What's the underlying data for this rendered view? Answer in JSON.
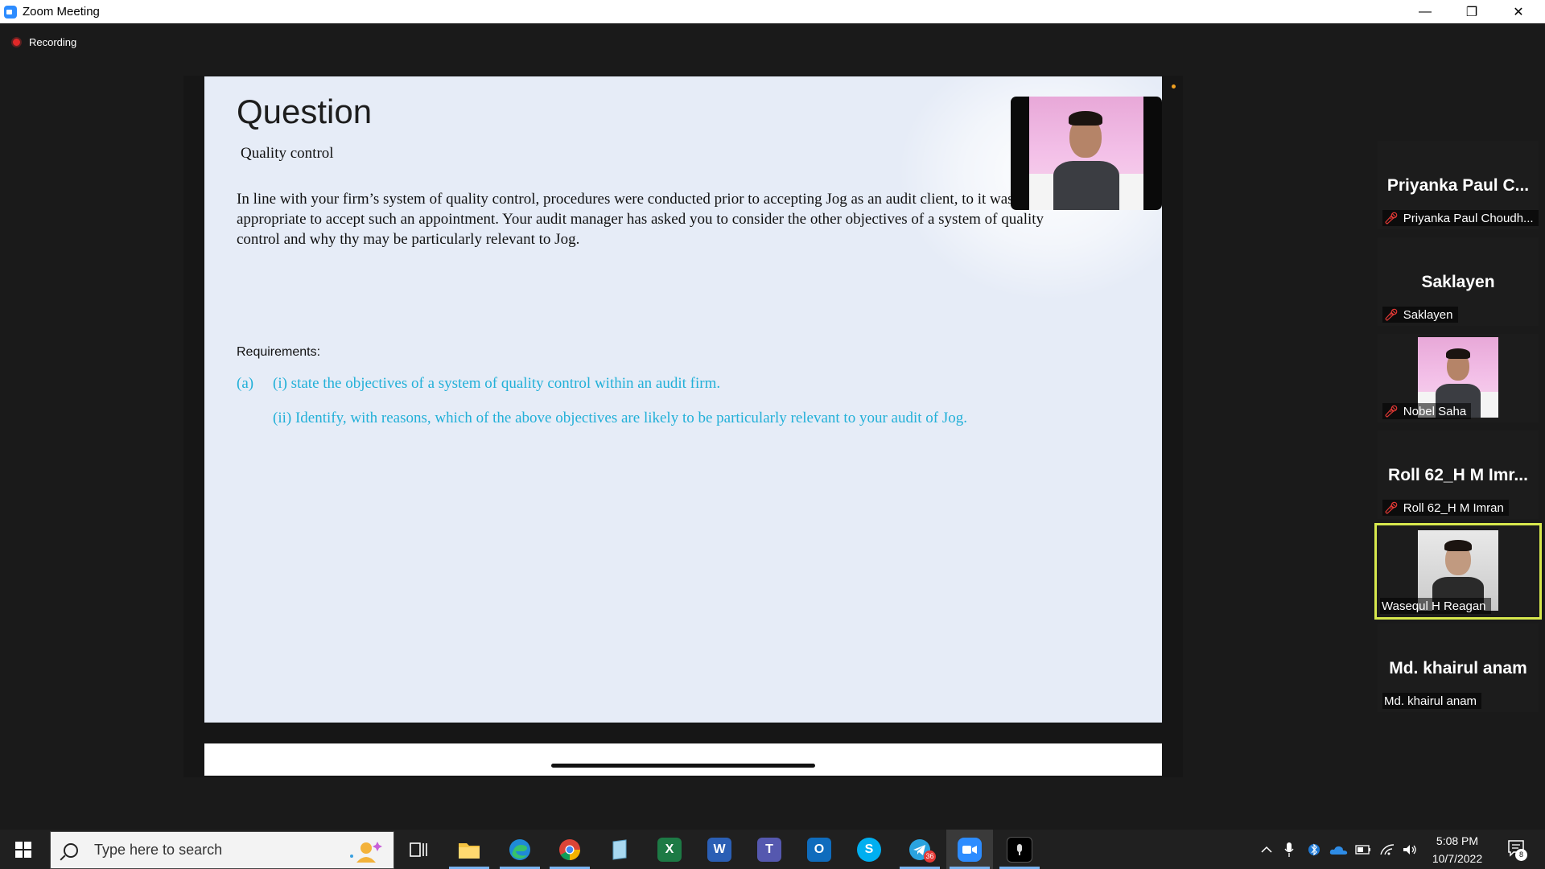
{
  "window": {
    "title": "Zoom Meeting"
  },
  "recording": {
    "label": "Recording"
  },
  "slide": {
    "title": "Question",
    "subtitle": "Quality control",
    "body": "In line with your firm’s system of quality control, procedures were conducted prior to accepting Jog as an audit client, to it was appropriate to accept such an appointment. Your audit manager has asked you to consider the other objectives of a system of quality control and why thy may be particularly relevant to Jog.",
    "requirements_label": "Requirements:",
    "item_label": "(a)",
    "item_i": "(i) state the objectives of a system of quality control within an audit firm.",
    "item_ii": "(ii) Identify, with reasons, which of the above objectives are likely to be particularly relevant to your audit of Jog."
  },
  "participants": [
    {
      "big_name": "Priyanka Paul C...",
      "name": "Priyanka Paul Choudh...",
      "muted": true,
      "video": false,
      "speaking": false
    },
    {
      "big_name": "Saklayen",
      "name": "Saklayen",
      "muted": true,
      "video": false,
      "speaking": false
    },
    {
      "big_name": "",
      "name": "Nobel Saha",
      "muted": true,
      "video": true,
      "speaking": false
    },
    {
      "big_name": "Roll 62_H M Imr...",
      "name": "Roll 62_H M Imran",
      "muted": true,
      "video": false,
      "speaking": false
    },
    {
      "big_name": "",
      "name": "Wasequl H Reagan",
      "muted": false,
      "video": true,
      "speaking": true
    },
    {
      "big_name": "Md. khairul anam",
      "name": "Md. khairul anam",
      "muted": false,
      "video": false,
      "speaking": false
    }
  ],
  "taskbar": {
    "search_placeholder": "Type here to search",
    "apps": [
      {
        "icon": "task-view-icon"
      },
      {
        "icon": "file-explorer-icon"
      },
      {
        "icon": "edge-icon"
      },
      {
        "icon": "chrome-icon"
      },
      {
        "icon": "notepad-icon"
      },
      {
        "icon": "excel-icon",
        "glyph": "X"
      },
      {
        "icon": "word-icon",
        "glyph": "W"
      },
      {
        "icon": "teams-icon",
        "glyph": "T"
      },
      {
        "icon": "outlook-icon",
        "glyph": "O"
      },
      {
        "icon": "skype-icon",
        "glyph": "S"
      },
      {
        "icon": "telegram-icon",
        "badge": "36"
      },
      {
        "icon": "zoom-icon"
      },
      {
        "icon": "app-icon"
      }
    ],
    "clock_time": "5:08 PM",
    "clock_date": "10/7/2022",
    "notification_count": "8"
  },
  "colors": {
    "accent_text": "#22b0d8",
    "speaker_border": "#d7e84d",
    "mute_red": "#e53935"
  }
}
